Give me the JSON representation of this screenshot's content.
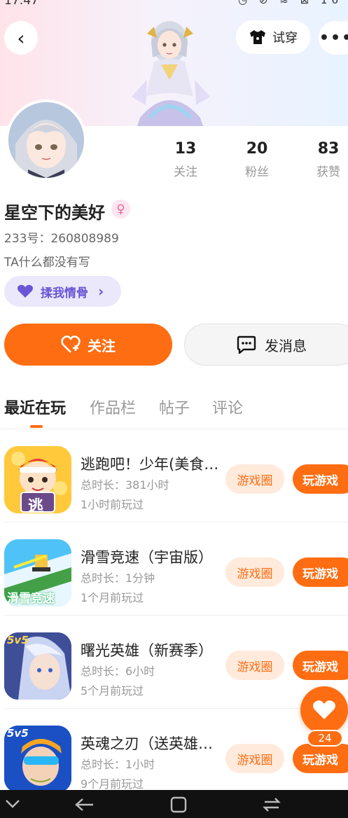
{
  "status_bar": {
    "time": "17:47",
    "icons": "◷ ⊘ ≋ ⊠ 16"
  },
  "header": {
    "back_icon": "‹",
    "tryon_label": "试穿",
    "more_icon": "•••"
  },
  "profile": {
    "stats": [
      {
        "value": "13",
        "label": "关注"
      },
      {
        "value": "20",
        "label": "粉丝"
      },
      {
        "value": "83",
        "label": "获赞"
      }
    ],
    "nickname": "星空下的美好",
    "gender_icon": "♀",
    "uid": "233号：260808989",
    "bio": "TA什么都没有写",
    "affinity_label": "揉我情骨",
    "affinity_chevron": "›"
  },
  "actions": {
    "follow_label": "关注",
    "message_label": "发消息"
  },
  "tabs": [
    "最近在玩",
    "作品栏",
    "帖子",
    "评论"
  ],
  "games": [
    {
      "name": "逃跑吧！少年(美食…",
      "duration": "总时长：381小时",
      "last_played": "1小时前玩过",
      "circle_label": "游戏圈",
      "play_label": "玩游戏"
    },
    {
      "name": "滑雪竞速（宇宙版）",
      "duration": "总时长：1分钟",
      "last_played": "1个月前玩过",
      "circle_label": "游戏圈",
      "play_label": "玩游戏"
    },
    {
      "name": "曙光英雄（新赛季）",
      "duration": "总时长：6小时",
      "last_played": "5个月前玩过",
      "circle_label": "游戏圈",
      "play_label": "玩游戏"
    },
    {
      "name": "英魂之刃（送英雄…",
      "duration": "总时长：1小时",
      "last_played": "9个月前玩过",
      "circle_label": "游戏圈",
      "play_label": "玩游戏"
    }
  ],
  "game_icon_texts": {
    "g1": "逃",
    "g2": "滑雪竞速",
    "g3": "5v5",
    "g4": "5v5"
  },
  "fab": {
    "badge": "24"
  },
  "colors": {
    "accent": "#ff6d12",
    "accent_light": "#ffeadb",
    "purple": "#6a55d6",
    "text_gray": "#999999"
  }
}
